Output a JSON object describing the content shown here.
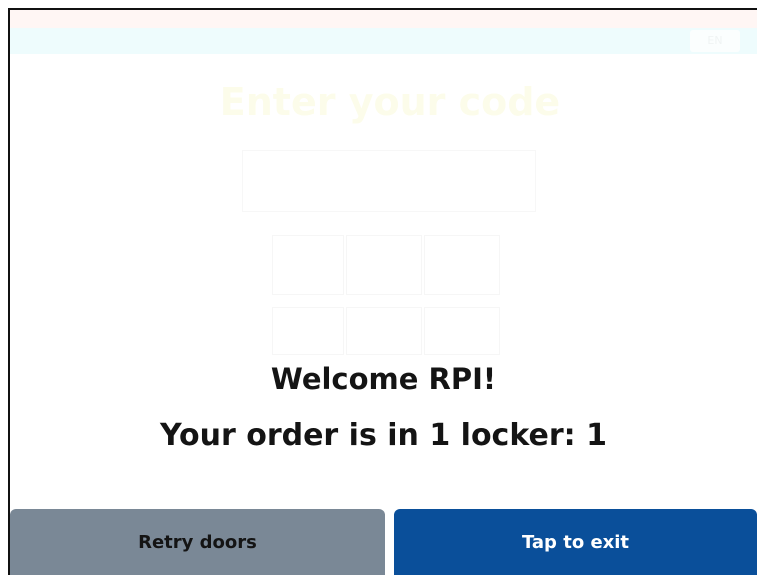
{
  "background_screen": {
    "title": "Enter your code",
    "language_button": "EN"
  },
  "dialog": {
    "welcome": "Welcome RPI!",
    "order_message": "Your order is in 1 locker: 1"
  },
  "buttons": {
    "retry_label": "Retry doors",
    "exit_label": "Tap to exit"
  },
  "colors": {
    "retry_bg": "#7a8896",
    "exit_bg": "#0a4f9a",
    "text": "#141414"
  }
}
